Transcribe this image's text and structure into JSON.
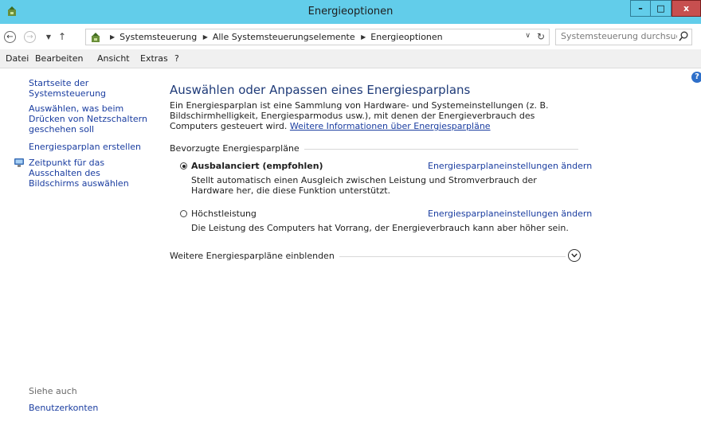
{
  "window": {
    "title": "Energieoptionen",
    "controls": {
      "minimize": "–",
      "maximize": "□",
      "close": "x"
    }
  },
  "address_bar": {
    "crumbs": [
      "Systemsteuerung",
      "Alle Systemsteuerungselemente",
      "Energieoptionen"
    ],
    "search_placeholder": "Systemsteuerung durchsuchen"
  },
  "menu": [
    "Datei",
    "Bearbeiten",
    "Ansicht",
    "Extras",
    "?"
  ],
  "left_pane": {
    "home": "Startseite der Systemsteuerung",
    "power_buttons": "Auswählen, was beim Drücken von Netzschaltern geschehen soll",
    "create_plan": "Energiesparplan erstellen",
    "display_off": "Zeitpunkt für das Ausschalten des Bildschirms auswählen",
    "see_also": "Siehe auch",
    "user_accounts": "Benutzerkonten"
  },
  "main": {
    "heading": "Auswählen oder Anpassen eines Energiesparplans",
    "intro": "Ein Energiesparplan ist eine Sammlung von Hardware- und Systemeinstellungen (z. B. Bildschirmhelligkeit, Energiesparmodus usw.), mit denen der Energieverbrauch des Computers gesteuert wird. ",
    "intro_link": "Weitere Informationen über Energiesparpläne",
    "section": "Bevorzugte Energiesparpläne",
    "plans": [
      {
        "name": "Ausbalanciert (empfohlen)",
        "selected": true,
        "link": "Energiesparplaneinstellungen ändern",
        "description": "Stellt automatisch einen Ausgleich zwischen Leistung und Stromverbrauch der Hardware her, die diese Funktion unterstützt."
      },
      {
        "name": "Höchstleistung",
        "selected": false,
        "link": "Energiesparplaneinstellungen ändern",
        "description": "Die Leistung des Computers hat Vorrang, der Energieverbrauch kann aber höher sein."
      }
    ],
    "more_plans": "Weitere Energiesparpläne einblenden",
    "help": "?"
  }
}
